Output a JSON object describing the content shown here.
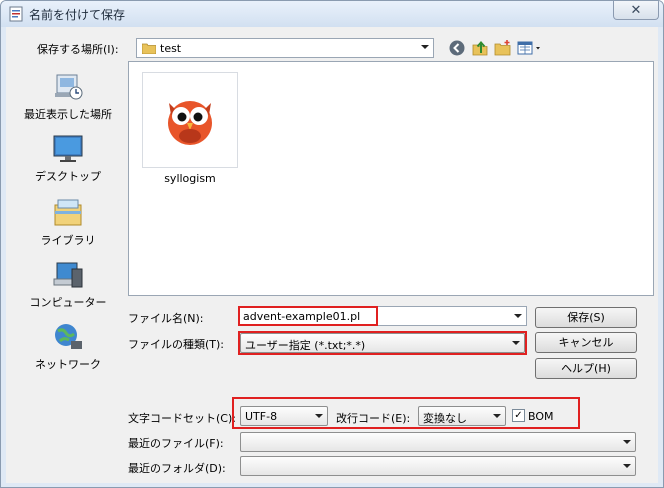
{
  "window": {
    "title": "名前を付けて保存",
    "close_label": "✕"
  },
  "lookin": {
    "label": "保存する場所(I):",
    "value": "test"
  },
  "sidebar": {
    "items": [
      {
        "label": "最近表示した場所",
        "icon": "recent-places-icon"
      },
      {
        "label": "デスクトップ",
        "icon": "desktop-icon"
      },
      {
        "label": "ライブラリ",
        "icon": "libraries-icon"
      },
      {
        "label": "コンピューター",
        "icon": "computer-icon"
      },
      {
        "label": "ネットワーク",
        "icon": "network-icon"
      }
    ]
  },
  "files": [
    {
      "name": "syllogism",
      "icon": "owl-icon"
    }
  ],
  "form": {
    "filename_label": "ファイル名(N):",
    "filename_value": "advent-example01.pl",
    "filetype_label": "ファイルの種類(T):",
    "filetype_value": "ユーザー指定 (*.txt;*.*)",
    "charset_label": "文字コードセット(C):",
    "charset_value": "UTF-8",
    "newline_label": "改行コード(E):",
    "newline_value": "変換なし",
    "bom_label": "BOM",
    "bom_checked": true,
    "recent_files_label": "最近のファイル(F):",
    "recent_folders_label": "最近のフォルダ(D):"
  },
  "buttons": {
    "save": "保存(S)",
    "cancel": "キャンセル",
    "help": "ヘルプ(H)"
  },
  "colors": {
    "highlight": "#e02020"
  }
}
